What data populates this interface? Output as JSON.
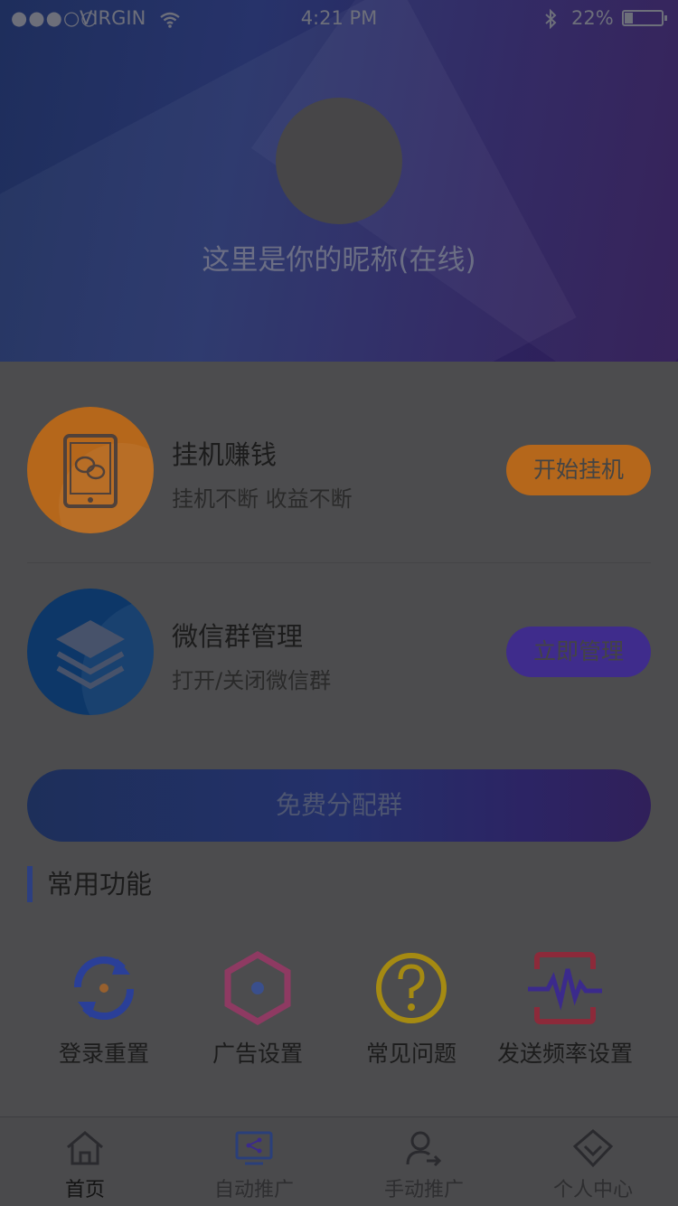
{
  "status_bar": {
    "signal": "●●●○○",
    "carrier": "VIRGIN",
    "time": "4:21 PM",
    "battery": "22%",
    "battery_level": 0.22
  },
  "profile": {
    "nickname": "这里是你的昵称(在线)"
  },
  "cards": [
    {
      "icon": "tablet-wechat-icon",
      "title": "挂机赚钱",
      "subtitle": "挂机不断  收益不断",
      "button": "开始挂机",
      "color": "#b5671b"
    },
    {
      "icon": "layers-icon",
      "title": "微信群管理",
      "subtitle": "打开/关闭微信群",
      "button": "立即管理",
      "color": "#3f2c8c"
    }
  ],
  "free_button": "免费分配群",
  "section_title": "常用功能",
  "functions": [
    {
      "icon": "refresh-icon",
      "label": "登录重置"
    },
    {
      "icon": "hexagon-icon",
      "label": "广告设置"
    },
    {
      "icon": "question-icon",
      "label": "常见问题"
    },
    {
      "icon": "pulse-icon",
      "label": "发送频率设置"
    }
  ],
  "tabs": [
    {
      "icon": "home-icon",
      "label": "首页",
      "active": true
    },
    {
      "icon": "share-screen-icon",
      "label": "自动推广",
      "active": false
    },
    {
      "icon": "user-arrow-icon",
      "label": "手动推广",
      "active": false
    },
    {
      "icon": "diamond-icon",
      "label": "个人中心",
      "active": false
    }
  ],
  "colors": {
    "accent_blue": "#2c3f82",
    "accent_orange": "#b5671b",
    "accent_purple": "#3f2c8c",
    "accent_pink": "#8e3a62",
    "accent_yellow": "#a58a12"
  }
}
